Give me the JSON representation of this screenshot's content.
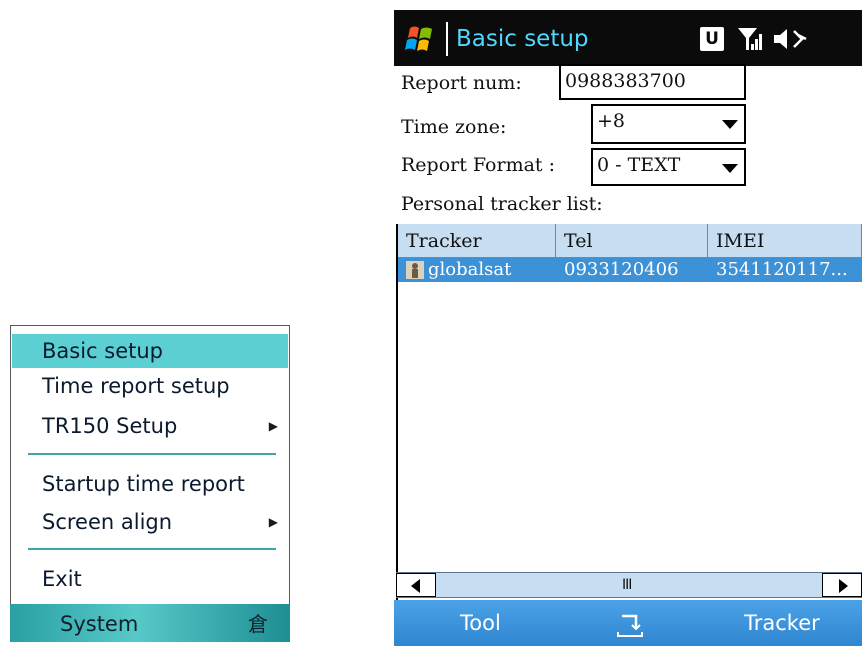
{
  "menu": {
    "items": [
      {
        "label": "Basic setup",
        "selected": true,
        "submenu": false
      },
      {
        "label": "Time report setup",
        "selected": false,
        "submenu": false
      },
      {
        "label": "TR150 Setup",
        "selected": false,
        "submenu": true
      },
      {
        "label": "Startup time report",
        "selected": false,
        "submenu": false
      },
      {
        "label": "Screen align",
        "selected": false,
        "submenu": true
      },
      {
        "label": "Exit",
        "selected": false,
        "submenu": false
      }
    ],
    "softkey_label": "System",
    "keyboard_icon": "keyboard-icon"
  },
  "screen": {
    "title": "Basic setup",
    "status_u": "U",
    "form": {
      "report_num_label": "Report num:",
      "report_num_value": "0988383700",
      "time_zone_label": "Time zone:",
      "time_zone_value": "+8",
      "report_format_label": "Report Format :",
      "report_format_value": "0 - TEXT",
      "tracker_list_label": "Personal tracker list:"
    },
    "table": {
      "columns": [
        "Tracker",
        "Tel",
        "IMEI"
      ],
      "rows": [
        {
          "tracker": "globalsat",
          "tel": "0933120406",
          "imei": "3541120117..."
        }
      ]
    },
    "scroll_grip": "III",
    "softkeys": {
      "left": "Tool",
      "right": "Tracker"
    }
  },
  "colors": {
    "menu_highlight": "#5ccfd2",
    "title_text": "#4fd8ff",
    "row_selected": "#3d91d6",
    "header_bg": "#c7ddf2",
    "softbar": "#2f86d1"
  }
}
